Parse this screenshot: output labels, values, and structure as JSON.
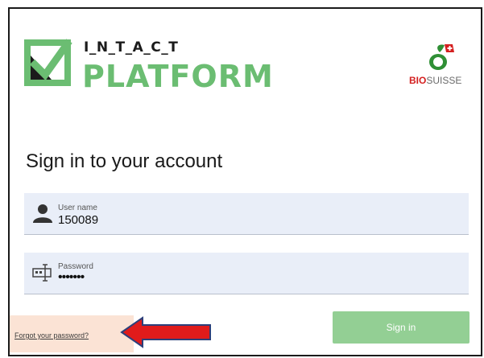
{
  "brand": {
    "intact_text": "I_N_T_A_C_T",
    "platform_text": "PLATFORM",
    "partner_bold": "BIO",
    "partner_rest": "SUISSE"
  },
  "login": {
    "heading": "Sign in to your account",
    "username": {
      "label": "User name",
      "value": "150089"
    },
    "password": {
      "label": "Password",
      "value": "•••••••"
    },
    "forgot_link": "Forgot your password?",
    "signin_button": "Sign in"
  },
  "icons": {
    "platform_logo": "checkbox-logo-icon",
    "partner_logo": "bio-suisse-bud-icon",
    "user_field": "user-icon",
    "password_field": "password-icon",
    "annotation": "red-arrow-icon"
  },
  "colors": {
    "brand_green": "#6bbd72",
    "button_green": "#93cf94",
    "field_background": "#e9eef8",
    "annotation_red": "#e01b1b",
    "highlight_peach": "#fbe3d5",
    "partner_red": "#d41f1f"
  }
}
